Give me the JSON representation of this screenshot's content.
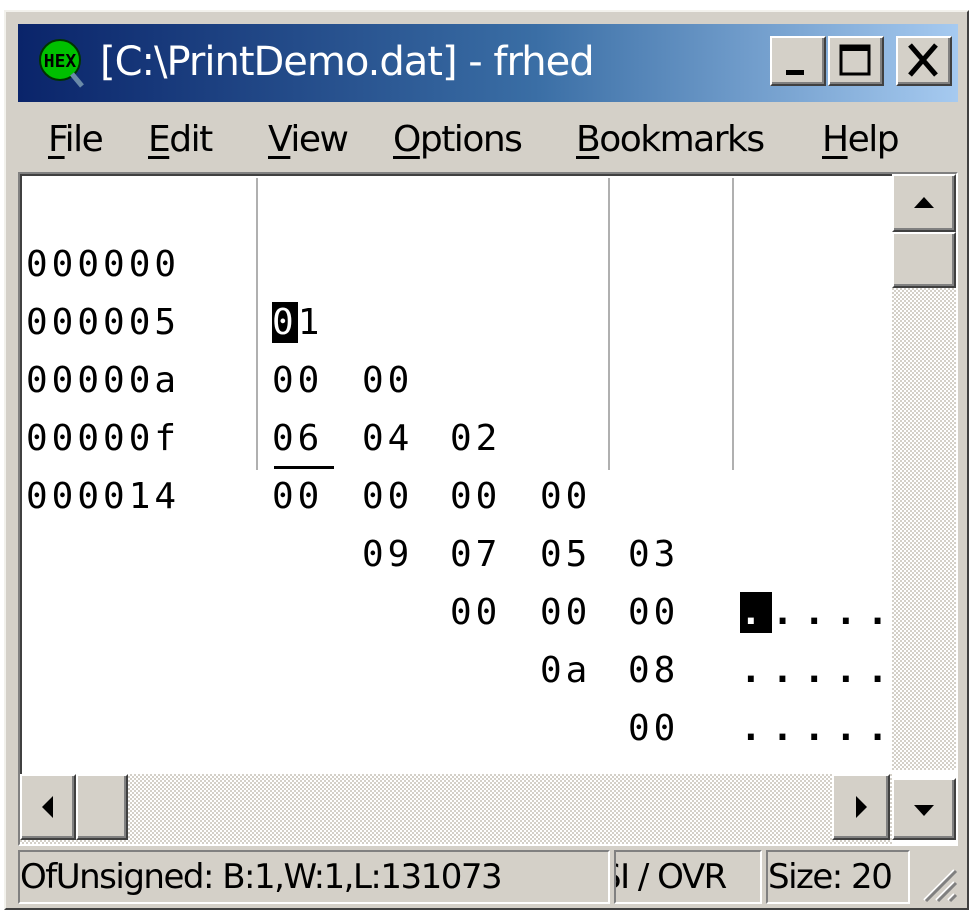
{
  "window": {
    "title": "[C:\\PrintDemo.dat] - frhed",
    "app_icon": "frhed-hex-icon",
    "controls": [
      "minimize",
      "maximize",
      "close"
    ]
  },
  "menu": {
    "file": {
      "accel": "F",
      "rest": "ile"
    },
    "edit": {
      "accel": "E",
      "rest": "dit"
    },
    "view": {
      "accel": "V",
      "rest": "iew"
    },
    "options": {
      "accel": "O",
      "rest": "ptions"
    },
    "bookmarks": {
      "accel": "B",
      "rest": "ookmarks"
    },
    "help": {
      "accel": "H",
      "rest": "elp"
    }
  },
  "hex": {
    "rows": [
      {
        "offset": "000000",
        "bytes": [
          "01",
          "00",
          "02",
          "00",
          "03"
        ],
        "ascii": "....."
      },
      {
        "offset": "000005",
        "bytes": [
          "00",
          "04",
          "00",
          "05",
          "00"
        ],
        "ascii": "....."
      },
      {
        "offset": "00000a",
        "bytes": [
          "06",
          "00",
          "07",
          "00",
          "08"
        ],
        "ascii": "....."
      },
      {
        "offset": "00000f",
        "bytes": [
          "00",
          "09",
          "00",
          "0a",
          "00"
        ],
        "ascii": "....."
      },
      {
        "offset": "000014",
        "bytes": [],
        "ascii": ""
      }
    ],
    "caret": {
      "row": 0,
      "byte": 0,
      "nibble": 0
    },
    "caret_ascii_char": "."
  },
  "statusbar": {
    "value_info": "OfUnsigned: B:1,W:1,L:131073",
    "mode": "SI / OVR",
    "size": "Size: 20"
  },
  "colors": {
    "title_gradient_start": "#0a246a",
    "title_gradient_end": "#a6caf0",
    "face": "#d4d0c8",
    "caret": "#000000"
  }
}
